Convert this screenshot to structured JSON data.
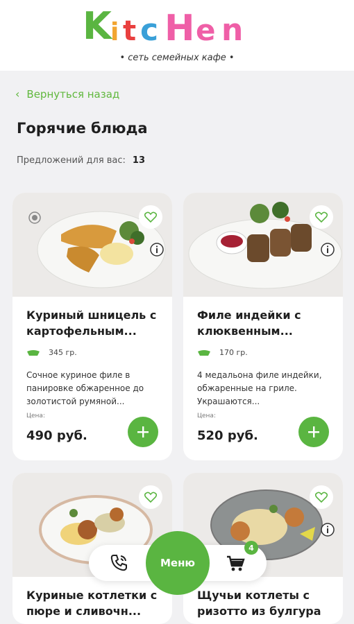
{
  "header": {
    "logo_text": "KitcHen",
    "tagline": "• сеть семейных кафе •"
  },
  "nav": {
    "back_label": "Вернуться назад"
  },
  "page": {
    "title": "Горячие блюда",
    "offers_label": "Предложений для вас:",
    "offers_count": "13"
  },
  "colors": {
    "accent": "#5ab541",
    "link": "#61b83e"
  },
  "cards": [
    {
      "name": "Куриный шницель с картофельным...",
      "weight": "345 гр.",
      "description": "Сочное куриное филе в панировке обжаренное до золотистой румяной...",
      "price_label": "Цена:",
      "price": "490 руб."
    },
    {
      "name": "Филе индейки с клюквенным...",
      "weight": "170 гр.",
      "description": "4 медальона филе индейки, обжаренные на гриле. Украшаются...",
      "price_label": "Цена:",
      "price": "520 руб."
    },
    {
      "name": "Куриные котлетки с пюре и сливочн..."
    },
    {
      "name": "Щучьи котлеты с ризотто из булгура"
    }
  ],
  "bottom_nav": {
    "menu_label": "Меню",
    "cart_count": "4"
  },
  "icons": [
    "chevron-left-icon",
    "heart-icon",
    "info-icon",
    "halal-icon",
    "weight-icon",
    "plus-icon",
    "phone-icon",
    "cart-icon"
  ]
}
